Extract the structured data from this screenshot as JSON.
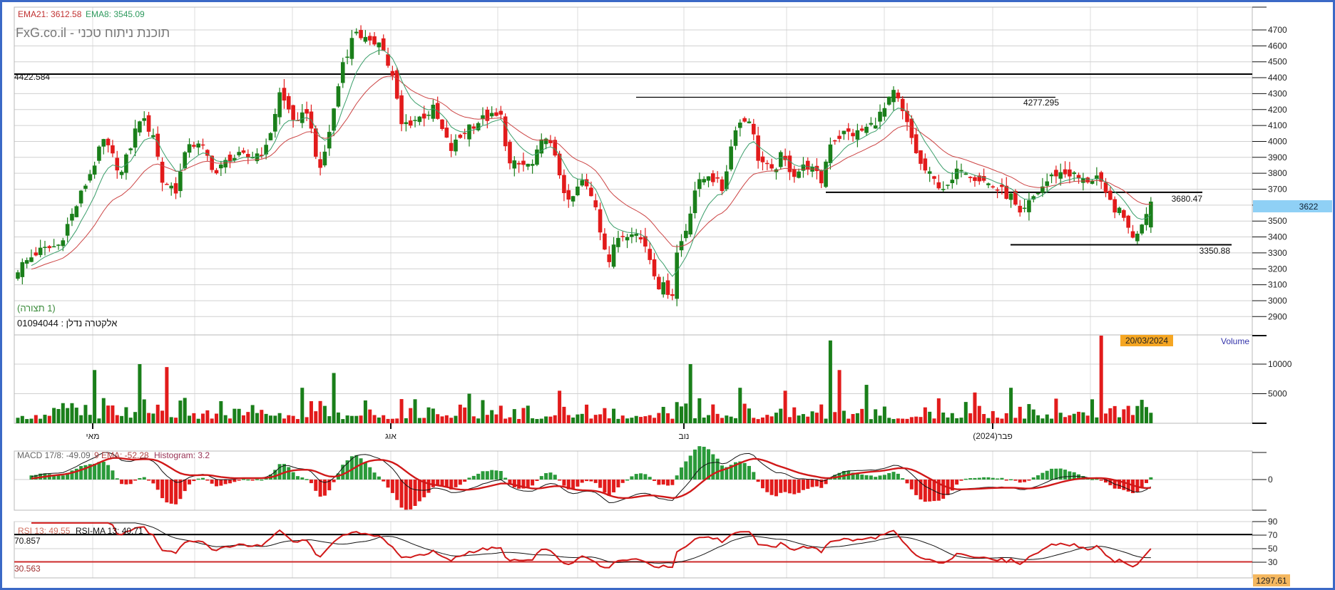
{
  "legend": {
    "ema21": "EMA21: 3612.58",
    "ema8": "EMA8: 3545.09",
    "watermark": "FxG.co.il - תוכנת ניתוח טכני",
    "config": "(1 תצורה)",
    "instrument": "אלקטרה נדלן : 01094044",
    "last_price": "3622",
    "volume_title": "Volume",
    "cursor_date": "20/03/2024",
    "macd": "MACD 17/8: -49.09",
    "macd_signal": "9 EMA: -52.28",
    "macd_hist": "Histogram: 3.2",
    "rsi": "RSI 13: 49.55",
    "rsi_ma": "RSI-MA 13: 40.71",
    "rsi_upper": "70.857",
    "rsi_lower": "30.563",
    "corner_value": "1297.61"
  },
  "colors": {
    "up": "#1a7f1a",
    "down": "#e21b1b",
    "ema21": "#cc4444",
    "ema8": "#3a9e6a",
    "frame": "#3b69c6",
    "price_tag": "#8fd0f5",
    "date_tag": "#f5a623"
  },
  "chart_data": {
    "type": "candlestick",
    "title": "אלקטרה נדלן",
    "months": [
      "מאי",
      "אוג",
      "נוב",
      "פבר(2024)"
    ],
    "price_axis": {
      "ylim": [
        2800,
        4800
      ],
      "ticks": [
        2900,
        3000,
        3100,
        3200,
        3300,
        3400,
        3500,
        3600,
        3700,
        3800,
        3900,
        4000,
        4100,
        4200,
        4300,
        4400,
        4500,
        4600,
        4700
      ]
    },
    "close_path": [
      [
        0,
        3200
      ],
      [
        4,
        3300
      ],
      [
        9,
        3350
      ],
      [
        13,
        3600
      ],
      [
        19,
        4000
      ],
      [
        23,
        3800
      ],
      [
        27,
        4150
      ],
      [
        30,
        4050
      ],
      [
        32,
        3750
      ],
      [
        35,
        3700
      ],
      [
        38,
        4000
      ],
      [
        41,
        3950
      ],
      [
        44,
        3800
      ],
      [
        47,
        3900
      ],
      [
        51,
        3900
      ],
      [
        55,
        3950
      ],
      [
        58,
        4300
      ],
      [
        62,
        4100
      ],
      [
        64,
        4200
      ],
      [
        67,
        3800
      ],
      [
        70,
        4200
      ],
      [
        72,
        4500
      ],
      [
        75,
        4700
      ],
      [
        78,
        4600
      ],
      [
        80,
        4650
      ],
      [
        83,
        4400
      ],
      [
        85,
        4100
      ],
      [
        89,
        4150
      ],
      [
        92,
        4200
      ],
      [
        95,
        4000
      ],
      [
        96,
        3950
      ],
      [
        100,
        4100
      ],
      [
        104,
        4150
      ],
      [
        107,
        4150
      ],
      [
        109,
        3850
      ],
      [
        112,
        3850
      ],
      [
        114,
        3850
      ],
      [
        117,
        4050
      ],
      [
        120,
        3800
      ],
      [
        122,
        3600
      ],
      [
        125,
        3750
      ],
      [
        128,
        3600
      ],
      [
        129,
        3450
      ],
      [
        131,
        3250
      ],
      [
        133,
        3400
      ],
      [
        136,
        3450
      ],
      [
        139,
        3350
      ],
      [
        142,
        3100
      ],
      [
        145,
        3050
      ],
      [
        146,
        3300
      ],
      [
        148,
        3450
      ],
      [
        150,
        3700
      ],
      [
        153,
        3800
      ],
      [
        156,
        3700
      ],
      [
        159,
        4100
      ],
      [
        162,
        4150
      ],
      [
        164,
        3900
      ],
      [
        167,
        3800
      ],
      [
        169,
        3900
      ],
      [
        172,
        3800
      ],
      [
        175,
        3850
      ],
      [
        178,
        3750
      ],
      [
        180,
        4000
      ],
      [
        183,
        4050
      ],
      [
        186,
        4050
      ],
      [
        189,
        4100
      ],
      [
        192,
        4200
      ],
      [
        194,
        4300
      ],
      [
        195,
        4250
      ],
      [
        197,
        4100
      ],
      [
        200,
        3850
      ],
      [
        203,
        3750
      ],
      [
        206,
        3700
      ],
      [
        209,
        3850
      ],
      [
        211,
        3800
      ],
      [
        214,
        3750
      ],
      [
        217,
        3700
      ],
      [
        220,
        3650
      ],
      [
        222,
        3520
      ],
      [
        225,
        3650
      ],
      [
        228,
        3750
      ],
      [
        230,
        3800
      ],
      [
        233,
        3800
      ],
      [
        236,
        3750
      ],
      [
        239,
        3780
      ],
      [
        241,
        3650
      ],
      [
        244,
        3550
      ],
      [
        246,
        3480
      ],
      [
        247,
        3380
      ],
      [
        249,
        3500
      ],
      [
        251,
        3622
      ]
    ],
    "levels": [
      {
        "label": "4422.584",
        "value": 4422.584
      },
      {
        "label": "4277.295",
        "value": 4277.295
      },
      {
        "label": "3680.47",
        "value": 3680.47
      },
      {
        "label": "3350.88",
        "value": 3350.88
      }
    ],
    "volume": {
      "ticks": [
        5000,
        10000
      ],
      "peaks": [
        [
          17,
          9000
        ],
        [
          27,
          10000
        ],
        [
          33,
          9500
        ],
        [
          70,
          8500
        ],
        [
          149,
          10000
        ],
        [
          180,
          14000
        ],
        [
          182,
          9000
        ],
        [
          240,
          16000
        ],
        [
          63,
          6000
        ],
        [
          100,
          5000
        ],
        [
          120,
          5500
        ],
        [
          160,
          6000
        ],
        [
          170,
          5500
        ],
        [
          188,
          6500
        ],
        [
          220,
          6000
        ],
        [
          212,
          5200
        ]
      ]
    },
    "macd": {
      "fast": 8,
      "slow": 17,
      "signal": 9,
      "ticks": [
        0
      ]
    },
    "rsi": {
      "period": 13,
      "ma": 13,
      "ticks": [
        30,
        50,
        70,
        90
      ],
      "upper": 70.857,
      "lower": 30.563
    }
  }
}
